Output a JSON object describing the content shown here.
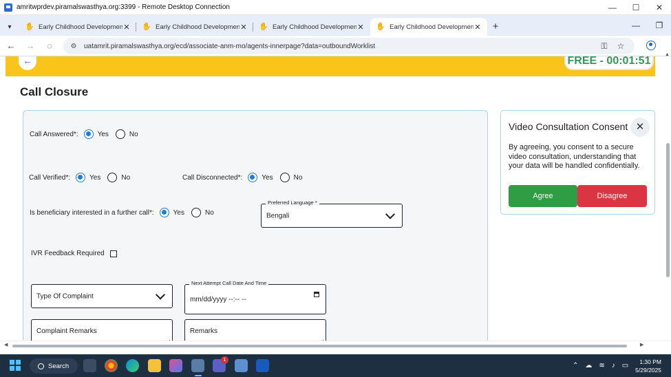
{
  "window": {
    "title": "amritwprdev.piramalswasthya.org:3399 - Remote Desktop Connection",
    "controls": [
      "—",
      "☐",
      "✕"
    ]
  },
  "browser": {
    "tabs": [
      {
        "label": "Early Childhood Development",
        "active": false
      },
      {
        "label": "Early Childhood Development",
        "active": false
      },
      {
        "label": "Early Childhood Development",
        "active": false
      },
      {
        "label": "Early Childhood Development",
        "active": true
      }
    ],
    "tab_close": "✕",
    "new_tab": "+",
    "url": "uatamrit.piramalswasthya.org/ecd/associate-anm-mo/agents-innerpage?data=outboundWorklist"
  },
  "header": {
    "timer": "FREE - 00:01:51"
  },
  "page": {
    "title": "Call Closure"
  },
  "form": {
    "call_answered": {
      "label": "Call Answered*:",
      "options": [
        "Yes",
        "No"
      ],
      "selected": "Yes"
    },
    "call_verified": {
      "label": "Call Verified*:",
      "options": [
        "Yes",
        "No"
      ],
      "selected": "Yes"
    },
    "call_disconnected": {
      "label": "Call Disconnected*:",
      "options": [
        "Yes",
        "No"
      ],
      "selected": "Yes"
    },
    "further_call": {
      "label": "Is beneficiary interested in a further call*:",
      "options": [
        "Yes",
        "No"
      ],
      "selected": "Yes"
    },
    "preferred_language": {
      "label": "Preferred Language *",
      "value": "Bengali"
    },
    "ivr_feedback": {
      "label": "IVR Feedback Required",
      "checked": false
    },
    "complaint_type": {
      "placeholder": "Type Of Complaint"
    },
    "next_attempt": {
      "label": "Next Attempt Call Date And Time",
      "value": "mm/dd/yyyy --:-- --"
    },
    "complaint_remarks": {
      "placeholder": "Complaint Remarks"
    },
    "remarks": {
      "placeholder": "Remarks"
    }
  },
  "video_consent": {
    "title": "Video Consultation Consent",
    "text": "By agreeing, you consent to a secure video consultation, understanding that your data will be handled confidentially.",
    "agree_label": "Agree",
    "disagree_label": "Disagree",
    "colors": {
      "agree": "#2f9d44",
      "disagree": "#db3442"
    }
  },
  "taskbar": {
    "search_label": "Search",
    "time": "1:30 PM",
    "date": "5/29/2025",
    "notification_count": "1"
  },
  "colors": {
    "header_bar": "#f9c51a",
    "timer_text": "#2e9a58",
    "radio_accent": "#1c7ed6",
    "card_border": "#a9d3e6"
  }
}
